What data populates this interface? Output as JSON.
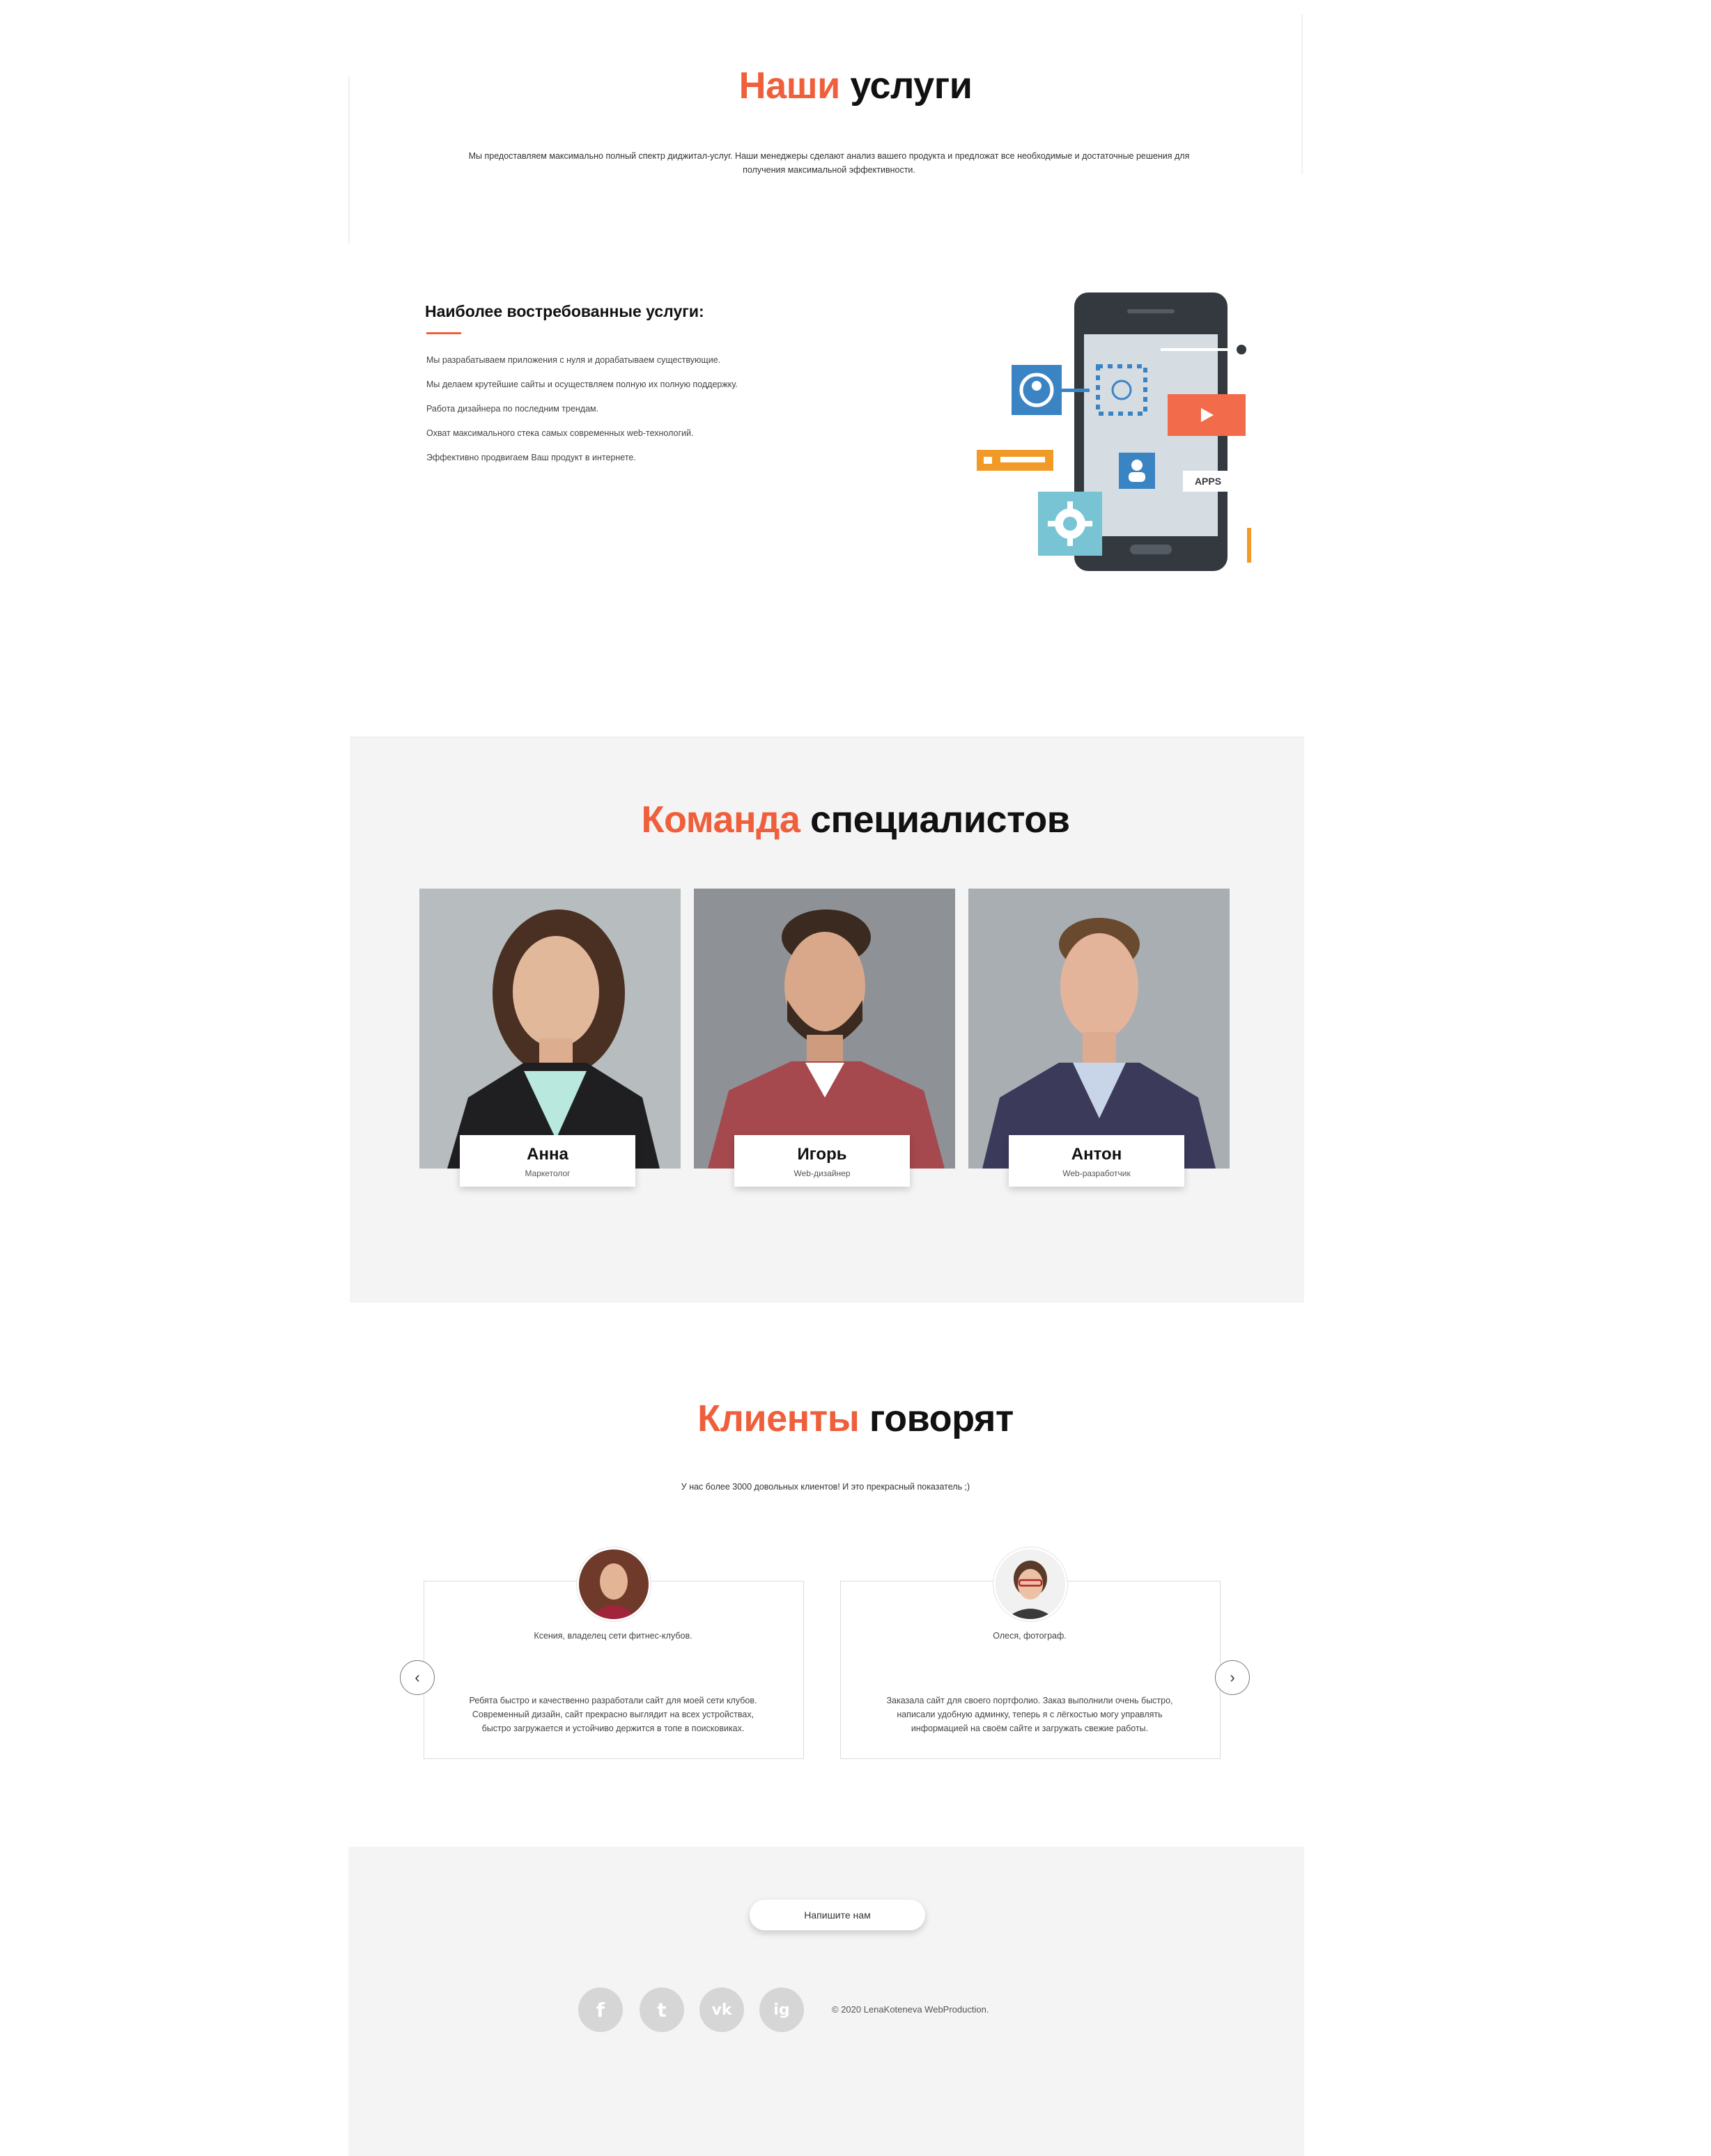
{
  "services": {
    "title_accent": "Наши",
    "title_rest": "услуги",
    "intro_line1": "Мы предоставляем максимально полный спектр диджитал-услуг. Наши менеджеры сделают анализ вашего продукта и предложат все необходимые и достаточные решения для",
    "intro_line2": "получения максимальной эффективности.",
    "list_title": "Наиболее востребованные услуги:",
    "items": [
      "Мы разрабатываем приложения с нуля и дорабатываем существующие.",
      "Мы делаем крутейшие сайты и осуществляем полную их полную поддержку.",
      "Работа дизайнера по последним трендам.",
      "Охват максимального стека самых современных web-технологий.",
      "Эффективно продвигаем Ваш продукт в интернете."
    ],
    "illustration_label": "APPS"
  },
  "team": {
    "title_accent": "Команда",
    "title_rest": "специалистов",
    "members": [
      {
        "name": "Анна",
        "role": "Маркетолог"
      },
      {
        "name": "Игорь",
        "role": "Web-дизайнер"
      },
      {
        "name": "Антон",
        "role": "Web-разработчик"
      }
    ]
  },
  "clients": {
    "title_accent": "Клиенты",
    "title_rest": "говорят",
    "subtitle": "У нас более 3000 довольных клиентов! И это прекрасный показатель ;)",
    "reviews": [
      {
        "author": "Ксения, владелец сети фитнес-клубов.",
        "line1": "Ребята быстро и качественно разработали сайт для моей сети клубов.",
        "line2": "Современный дизайн, сайт прекрасно выглядит на всех устройствах,",
        "line3": "быстро загружается и устойчиво держится в топе в поисковиках."
      },
      {
        "author": "Олеся, фотограф.",
        "line1": "Заказала сайт для своего портфолио. Заказ выполнили очень быстро,",
        "line2": "написали удобную админку, теперь я с лёгкостью могу управлять",
        "line3": "информацией на своём сайте и загружать свежие работы."
      }
    ],
    "prev_icon": "‹",
    "next_icon": "›"
  },
  "footer": {
    "contact_button": "Напишите нам",
    "social": [
      "f",
      "t",
      "vk",
      "ig"
    ],
    "copyright": "© 2020 LenaKoteneva WebProduction."
  },
  "colors": {
    "accent": "#ef5f3b",
    "section_bg": "#f4f4f4",
    "social_bg": "#d6d6d6"
  }
}
